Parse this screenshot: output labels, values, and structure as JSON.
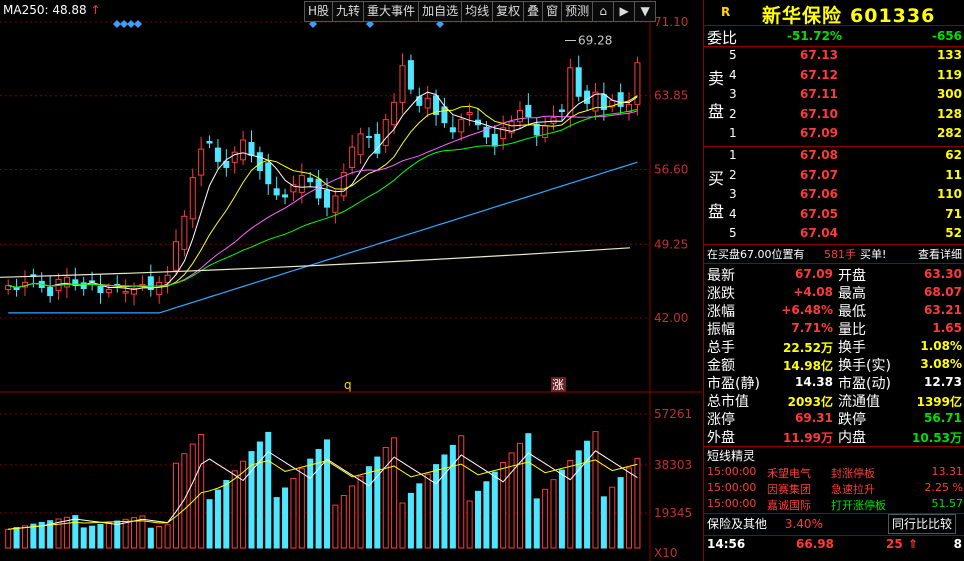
{
  "ma_label": {
    "text": "MA250: 48.88",
    "arrow": "↑"
  },
  "toolbar": [
    {
      "label": "H股",
      "name": "tab-h-share"
    },
    {
      "label": "九转",
      "name": "tab-nine-turn"
    },
    {
      "label": "重大事件",
      "name": "tab-major-events"
    },
    {
      "label": "加自选",
      "name": "tab-add-watchlist"
    },
    {
      "label": "均线",
      "name": "tab-moving-avg"
    },
    {
      "label": "复权",
      "name": "tab-adjust"
    },
    {
      "label": "叠",
      "name": "tab-overlay"
    },
    {
      "label": "窗",
      "name": "tab-window"
    },
    {
      "label": "预测",
      "name": "tab-forecast"
    }
  ],
  "toolbar_icons": [
    "lock-icon",
    "export-icon",
    "dropdown-icon"
  ],
  "price_axis": [
    "71.10",
    "63.85",
    "56.60",
    "49.25",
    "42.00"
  ],
  "volume_axis": [
    "57261",
    "38303",
    "19345",
    "X10"
  ],
  "peak_label": "69.28",
  "markers": {
    "q": "q",
    "zhang": "涨"
  },
  "header": {
    "r": "R",
    "name": "新华保险",
    "code": "601336"
  },
  "weibi": {
    "label": "委比",
    "pct": "-51.72%",
    "diff": "-656"
  },
  "sell_label": [
    "卖",
    "盘"
  ],
  "buy_label": [
    "买",
    "盘"
  ],
  "asks": [
    {
      "level": "5",
      "price": "67.13",
      "vol": "133"
    },
    {
      "level": "4",
      "price": "67.12",
      "vol": "119"
    },
    {
      "level": "3",
      "price": "67.11",
      "vol": "300"
    },
    {
      "level": "2",
      "price": "67.10",
      "vol": "128"
    },
    {
      "level": "1",
      "price": "67.09",
      "vol": "282"
    }
  ],
  "bids": [
    {
      "level": "1",
      "price": "67.08",
      "vol": "62"
    },
    {
      "level": "2",
      "price": "67.07",
      "vol": "11"
    },
    {
      "level": "3",
      "price": "67.06",
      "vol": "110"
    },
    {
      "level": "4",
      "price": "67.05",
      "vol": "71"
    },
    {
      "level": "5",
      "price": "67.04",
      "vol": "52"
    }
  ],
  "note": {
    "text": "在买盘67.00位置有",
    "qty": "581手",
    "action": "买单!",
    "detail": "查看详细"
  },
  "stats": [
    {
      "k1": "最新",
      "v1": "67.09",
      "c1": "red",
      "k2": "开盘",
      "v2": "63.30",
      "c2": "red"
    },
    {
      "k1": "涨跌",
      "v1": "+4.08",
      "c1": "red",
      "k2": "最高",
      "v2": "68.07",
      "c2": "red"
    },
    {
      "k1": "涨幅",
      "v1": "+6.48%",
      "c1": "red",
      "k2": "最低",
      "v2": "63.21",
      "c2": "red"
    },
    {
      "k1": "振幅",
      "v1": "7.71%",
      "c1": "red",
      "k2": "量比",
      "v2": "1.65",
      "c2": "red"
    },
    {
      "k1": "总手",
      "v1": "22.52万",
      "c1": "yel",
      "k2": "换手",
      "v2": "1.08%",
      "c2": "yel"
    },
    {
      "k1": "金额",
      "v1": "14.98亿",
      "c1": "yel",
      "k2": "换手(实)",
      "v2": "3.08%",
      "c2": "yel"
    },
    {
      "k1": "市盈(静)",
      "v1": "14.38",
      "c1": "white",
      "k2": "市盈(动)",
      "v2": "12.73",
      "c2": "white"
    },
    {
      "k1": "总市值",
      "v1": "2093亿",
      "c1": "yel",
      "k2": "流通值",
      "v2": "1399亿",
      "c2": "yel"
    },
    {
      "k1": "涨停",
      "v1": "69.31",
      "c1": "red",
      "k2": "跌停",
      "v2": "56.71",
      "c2": "green"
    },
    {
      "k1": "外盘",
      "v1": "11.99万",
      "c1": "red",
      "k2": "内盘",
      "v2": "10.53万",
      "c2": "green"
    }
  ],
  "shortline": {
    "title": "短线精灵",
    "rows": [
      {
        "time": "15:00:00",
        "stock": "禾望电气",
        "event": "封涨停板",
        "val": "13.31",
        "color": "red"
      },
      {
        "time": "15:00:00",
        "stock": "因赛集团",
        "event": "急速拉升",
        "val": "2.25 %",
        "color": "red"
      },
      {
        "time": "15:00:00",
        "stock": "嘉诚国际",
        "event": "打开涨停板",
        "val": "51.57",
        "color": "green"
      }
    ]
  },
  "bottom_tabs": {
    "sector": "保险及其他",
    "sector_pct": "3.40%",
    "compare": "同行比比较"
  },
  "trade": {
    "time": "14:56",
    "price": "66.98",
    "vol": "25",
    "arrow": "⇑",
    "num": "8"
  },
  "colors": {
    "up": "#ff3a3a",
    "down": "#4fe6ff",
    "ma5": "#ffffff",
    "ma10": "#ffff00",
    "ma20": "#ff66ff",
    "ma30": "#00ff00",
    "ma60": "#2fa8ff",
    "ma250": "#e8e8c8"
  }
}
